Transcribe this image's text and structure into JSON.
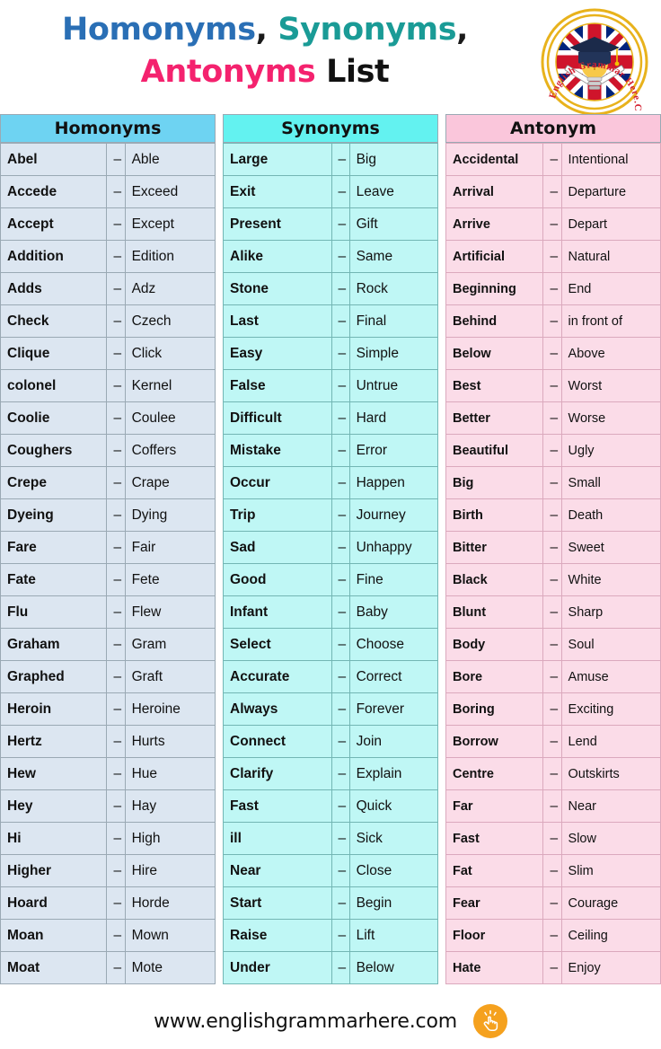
{
  "title": {
    "line1_part1": "Homonyms",
    "line1_sep1": ",",
    "line1_part2": "Synonyms",
    "line1_sep2": ",",
    "line2_part1": "Antonyms",
    "line2_part2": "List",
    "colors": {
      "homonyms": "#2A6FB5",
      "synonyms": "#1A9B96",
      "antonyms": "#F4226E",
      "list": "#111111"
    }
  },
  "logo": {
    "name": "english-grammar-here-logo",
    "text": "English Grammar Here.Com",
    "ring_color": "#E8B21C",
    "text_color": "#D32030"
  },
  "separator": "–",
  "columns": [
    {
      "id": "homonyms",
      "header": "Homonyms",
      "header_bg": "#6ED3F2",
      "cell_bg": "#DCE6F1",
      "rows": [
        [
          "Abel",
          "Able"
        ],
        [
          "Accede",
          "Exceed"
        ],
        [
          "Accept",
          "Except"
        ],
        [
          "Addition",
          "Edition"
        ],
        [
          "Adds",
          "Adz"
        ],
        [
          "Check",
          "Czech"
        ],
        [
          "Clique",
          "Click"
        ],
        [
          "colonel",
          "Kernel"
        ],
        [
          "Coolie",
          "Coulee"
        ],
        [
          "Coughers",
          "Coffers"
        ],
        [
          "Crepe",
          "Crape"
        ],
        [
          "Dyeing",
          "Dying"
        ],
        [
          "Fare",
          "Fair"
        ],
        [
          "Fate",
          "Fete"
        ],
        [
          "Flu",
          "Flew"
        ],
        [
          "Graham",
          "Gram"
        ],
        [
          "Graphed",
          "Graft"
        ],
        [
          "Heroin",
          "Heroine"
        ],
        [
          "Hertz",
          "Hurts"
        ],
        [
          "Hew",
          "Hue"
        ],
        [
          "Hey",
          "Hay"
        ],
        [
          "Hi",
          "High"
        ],
        [
          "Higher",
          "Hire"
        ],
        [
          "Hoard",
          "Horde"
        ],
        [
          "Moan",
          "Mown"
        ],
        [
          "Moat",
          "Mote"
        ]
      ]
    },
    {
      "id": "synonyms",
      "header": "Synonyms",
      "header_bg": "#63F2F0",
      "cell_bg": "#BFF7F5",
      "rows": [
        [
          "Large",
          "Big"
        ],
        [
          "Exit",
          "Leave"
        ],
        [
          "Present",
          "Gift"
        ],
        [
          "Alike",
          "Same"
        ],
        [
          "Stone",
          "Rock"
        ],
        [
          "Last",
          "Final"
        ],
        [
          "Easy",
          "Simple"
        ],
        [
          "False",
          "Untrue"
        ],
        [
          "Difficult",
          "Hard"
        ],
        [
          "Mistake",
          "Error"
        ],
        [
          "Occur",
          "Happen"
        ],
        [
          "Trip",
          "Journey"
        ],
        [
          "Sad",
          "Unhappy"
        ],
        [
          "Good",
          "Fine"
        ],
        [
          "Infant",
          "Baby"
        ],
        [
          "Select",
          "Choose"
        ],
        [
          "Accurate",
          "Correct"
        ],
        [
          "Always",
          "Forever"
        ],
        [
          "Connect",
          "Join"
        ],
        [
          "Clarify",
          "Explain"
        ],
        [
          "Fast",
          "Quick"
        ],
        [
          "ill",
          "Sick"
        ],
        [
          "Near",
          "Close"
        ],
        [
          "Start",
          "Begin"
        ],
        [
          "Raise",
          "Lift"
        ],
        [
          "Under",
          "Below"
        ]
      ]
    },
    {
      "id": "antonyms",
      "header": "Antonym",
      "header_bg": "#FAC6DB",
      "cell_bg": "#FBDCE8",
      "rows": [
        [
          "Accidental",
          "Intentional"
        ],
        [
          "Arrival",
          "Departure"
        ],
        [
          "Arrive",
          "Depart"
        ],
        [
          "Artificial",
          "Natural"
        ],
        [
          "Beginning",
          "End"
        ],
        [
          "Behind",
          "in front of"
        ],
        [
          "Below",
          "Above"
        ],
        [
          "Best",
          "Worst"
        ],
        [
          "Better",
          "Worse"
        ],
        [
          "Beautiful",
          "Ugly"
        ],
        [
          "Big",
          "Small"
        ],
        [
          "Birth",
          "Death"
        ],
        [
          "Bitter",
          "Sweet"
        ],
        [
          "Black",
          "White"
        ],
        [
          "Blunt",
          "Sharp"
        ],
        [
          "Body",
          "Soul"
        ],
        [
          "Bore",
          "Amuse"
        ],
        [
          "Boring",
          "Exciting"
        ],
        [
          "Borrow",
          "Lend"
        ],
        [
          "Centre",
          "Outskirts"
        ],
        [
          "Far",
          "Near"
        ],
        [
          "Fast",
          "Slow"
        ],
        [
          "Fat",
          "Slim"
        ],
        [
          "Fear",
          "Courage"
        ],
        [
          "Floor",
          "Ceiling"
        ],
        [
          "Hate",
          "Enjoy"
        ]
      ]
    }
  ],
  "footer": {
    "url": "www.englishgrammarhere.com",
    "badge_icon": "pointing-hand-icon",
    "badge_color": "#F5A11E"
  }
}
